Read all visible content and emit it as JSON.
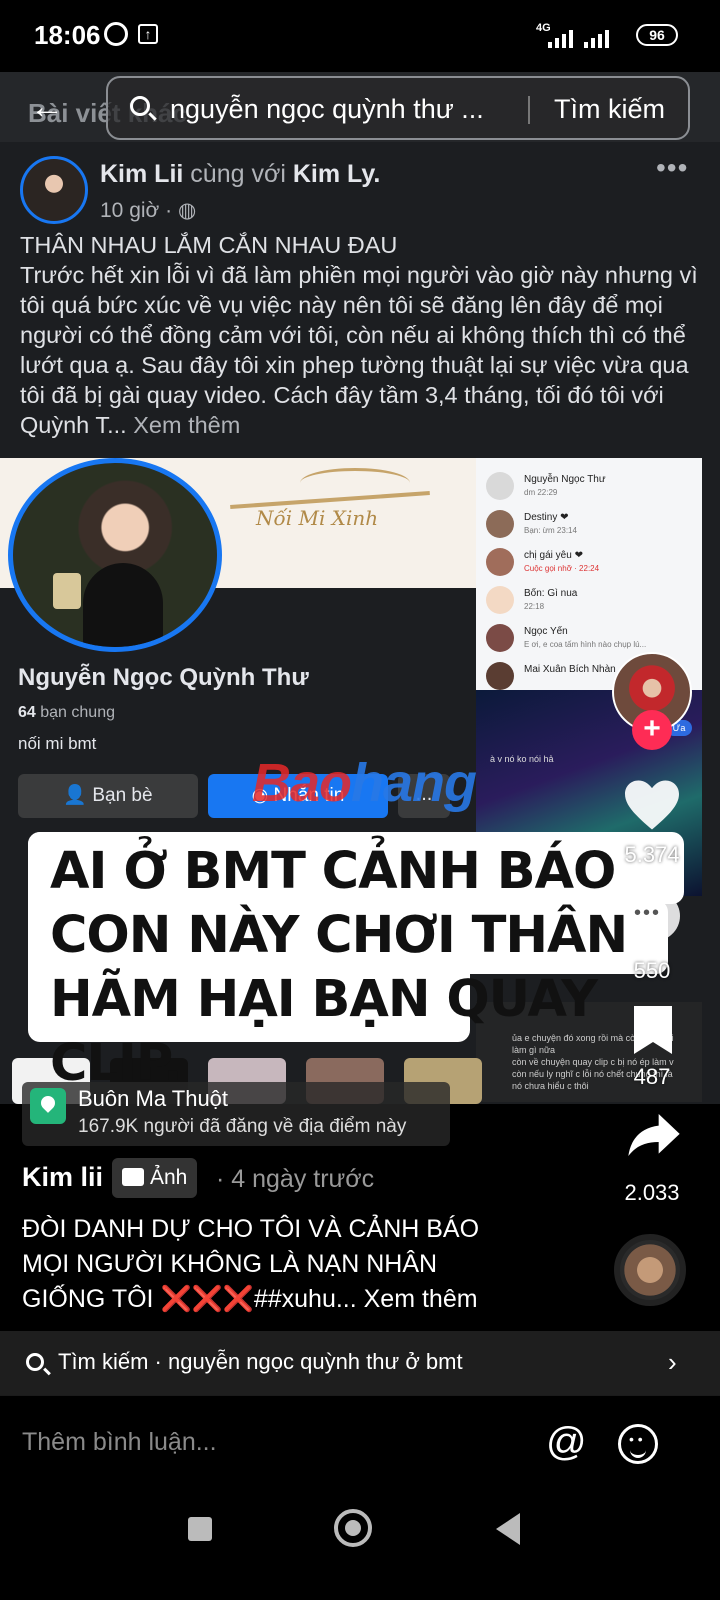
{
  "status_bar": {
    "time": "18:06",
    "network": "4G",
    "battery": "96"
  },
  "fb": {
    "back_ghost": "Bài viết khác",
    "search_query": "nguyễn ngọc quỳnh thư ...",
    "search_button": "Tìm kiếm",
    "post": {
      "author": "Kim Lii",
      "with_text": "cùng với",
      "tagged": "Kim Ly.",
      "time": "10 giờ ·",
      "dots": "•••",
      "text": "THÂN NHAU LẮM CẮN NHAU ĐAU\nTrước hết xin lỗi vì đã làm phiền mọi người vào giờ này nhưng vì tôi quá bức xúc về vụ việc này nên tôi sẽ đăng lên đây để mọi người có thể đồng cảm với tôi, còn nếu ai không thích thì có thể lướt qua ạ. Sau đây tôi xin phep tường thuật lại sự việc vừa qua tôi đã bị  gài quay video. Cách đây tầm 3,4 tháng, tối đó tôi với Quỳnh T...",
      "see_more": "Xem thêm"
    },
    "profile": {
      "cover_brand": "Nối Mi Xinh",
      "name": "Nguyễn Ngọc Quỳnh Thư",
      "mutual_count": "64",
      "mutual_label": "bạn chung",
      "bio": "nối mi bmt",
      "friend_button": "Bạn bè",
      "message_button": "Nhắn tin",
      "more_button": "..."
    },
    "chat": {
      "rows": [
        {
          "name": "Nguyễn Ngọc Thư",
          "sub": "dm 22:29"
        },
        {
          "name": "Destiny ❤",
          "sub": "Bạn: ừm 23:14"
        },
        {
          "name": "chị gái yêu ❤",
          "sub": "Cuộc gọi nhỡ · 22:24"
        },
        {
          "name": "Bốn: Gì nua",
          "sub": "22:18"
        },
        {
          "name": "Ngọc Yến",
          "sub": "E ơi, e coa tấm hình nào chụp lú..."
        },
        {
          "name": "Mai Xuân Bích Nhàn",
          "sub": ""
        }
      ],
      "aurora_bubble": "Ừa",
      "aurora_msg": "à v nó ko nói hả",
      "dark_msg": "ủa e chuyện đó xong rồi mà còn nhắc lại làm gì nữa\ncòn về chuyện quay clip c bị nó ép làm v còn nếu ly nghĩ c lỗi nó chết chung thì là nó chưa hiểu c thôi"
    },
    "watermark_red": "Bao",
    "watermark_blue": "hang"
  },
  "video": {
    "caption": "AI Ở BMT CẢNH BÁO CON NÀY CHƠI THÂN HÃM HẠI BẠN QUAY CLIP.",
    "likes": "5.374",
    "comments": "550",
    "saves": "487",
    "shares": "2.033",
    "location_name": "Buôn Ma Thuột",
    "location_sub": "167.9K người đã đăng về địa điểm này",
    "author": "Kim lii",
    "type_tag": "Ảnh",
    "ago": "· 4 ngày trước",
    "description_lines": [
      "ĐÒI DANH DỰ CHO TÔI VÀ CẢNH BÁO",
      "MỌI NGƯỜI KHÔNG LÀ NẠN NHÂN",
      "GIỐNG TÔI ❌❌❌##xuhu...  Xem thêm"
    ]
  },
  "search_suggestion": "Tìm kiếm · nguyễn ngọc quỳnh thư ở bmt",
  "comment_placeholder": "Thêm bình luận...",
  "colors": {
    "fb_blue": "#1877f2",
    "tiktok_red": "#fe2c55",
    "fb_dark": "#1c1e21"
  }
}
